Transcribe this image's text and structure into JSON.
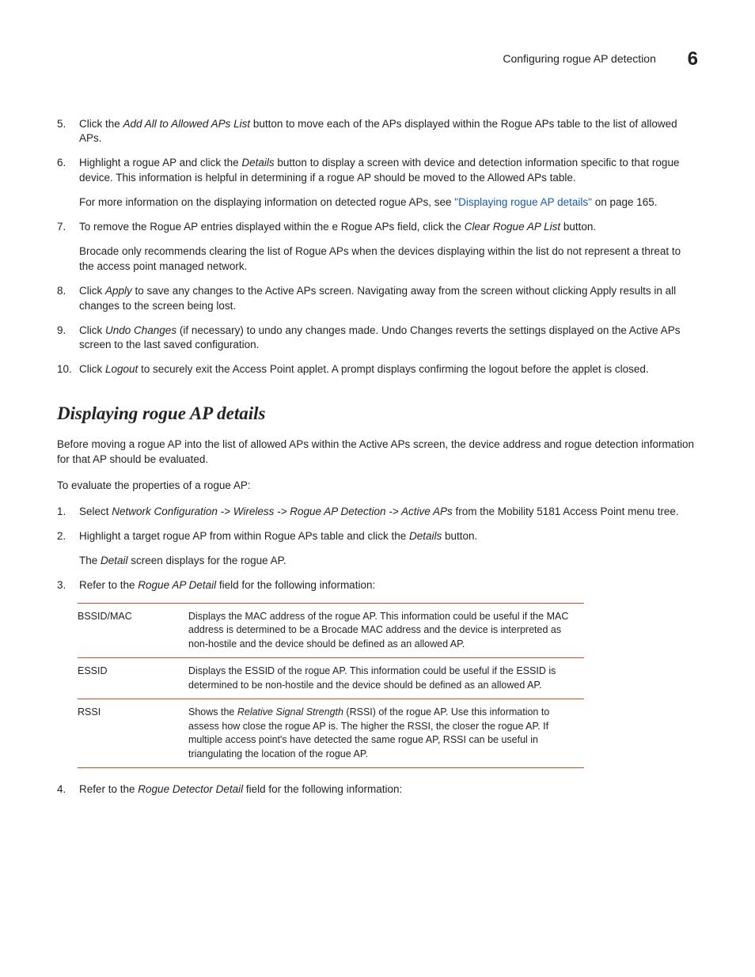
{
  "header": {
    "title": "Configuring rogue AP detection",
    "chapter": "6"
  },
  "list1": [
    {
      "num": "5.",
      "paras": [
        {
          "runs": [
            {
              "t": "Click the "
            },
            {
              "t": "Add All to Allowed APs List",
              "i": true
            },
            {
              "t": " button to move each of the APs displayed within the Rogue APs table to the list of allowed APs."
            }
          ]
        }
      ]
    },
    {
      "num": "6.",
      "paras": [
        {
          "runs": [
            {
              "t": "Highlight a rogue AP and click the "
            },
            {
              "t": "Details",
              "i": true
            },
            {
              "t": " button to display a screen with device and detection information specific to that rogue device. This information is helpful in determining if a rogue AP should be moved to the Allowed APs table."
            }
          ]
        },
        {
          "runs": [
            {
              "t": "For more information on the displaying information on detected rogue APs, see "
            },
            {
              "t": "\"Displaying rogue AP details\"",
              "link": true
            },
            {
              "t": " on page 165."
            }
          ]
        }
      ]
    },
    {
      "num": "7.",
      "paras": [
        {
          "runs": [
            {
              "t": "To remove the Rogue AP entries displayed within the e Rogue APs field, click the "
            },
            {
              "t": "Clear Rogue AP List",
              "i": true
            },
            {
              "t": " button."
            }
          ]
        },
        {
          "runs": [
            {
              "t": "Brocade only recommends clearing the list of Rogue APs when the devices displaying within the list do not represent a threat to the access point managed network."
            }
          ]
        }
      ]
    },
    {
      "num": "8.",
      "paras": [
        {
          "runs": [
            {
              "t": "Click "
            },
            {
              "t": "Apply",
              "i": true
            },
            {
              "t": " to save any changes to the Active APs screen. Navigating away from the screen without clicking Apply results in all changes to the screen being lost."
            }
          ]
        }
      ]
    },
    {
      "num": "9.",
      "paras": [
        {
          "runs": [
            {
              "t": "Click "
            },
            {
              "t": "Undo Changes",
              "i": true
            },
            {
              "t": " (if necessary) to undo any changes made. Undo Changes reverts the settings displayed on the Active APs screen to the last saved configuration."
            }
          ]
        }
      ]
    },
    {
      "num": "10.",
      "paras": [
        {
          "runs": [
            {
              "t": "Click "
            },
            {
              "t": "Logout",
              "i": true
            },
            {
              "t": " to securely exit the Access Point applet. A prompt displays confirming the logout before the applet is closed."
            }
          ]
        }
      ]
    }
  ],
  "section": {
    "title": "Displaying rogue AP details",
    "intro": "Before moving a rogue AP into the list of allowed APs within the Active APs screen, the device address and rogue detection information for that AP should be evaluated.",
    "lead": "To evaluate the properties of a rogue AP:"
  },
  "list2": [
    {
      "num": "1.",
      "paras": [
        {
          "runs": [
            {
              "t": "Select "
            },
            {
              "t": "Network Configuration -> Wireless -> Rogue AP Detection -> Active APs",
              "i": true
            },
            {
              "t": " from the Mobility 5181 Access Point menu tree."
            }
          ]
        }
      ]
    },
    {
      "num": "2.",
      "paras": [
        {
          "runs": [
            {
              "t": "Highlight a target rogue AP from within Rogue APs table and click the "
            },
            {
              "t": "Details",
              "i": true
            },
            {
              "t": " button."
            }
          ]
        },
        {
          "runs": [
            {
              "t": "The "
            },
            {
              "t": "Detail",
              "i": true
            },
            {
              "t": " screen displays for the rogue AP."
            }
          ]
        }
      ]
    },
    {
      "num": "3.",
      "paras": [
        {
          "runs": [
            {
              "t": "Refer to the "
            },
            {
              "t": "Rogue AP Detail",
              "i": true
            },
            {
              "t": " field for the following information:"
            }
          ]
        }
      ]
    }
  ],
  "table": [
    {
      "term": "BSSID/MAC",
      "desc": {
        "runs": [
          {
            "t": "Displays the MAC address of the rogue AP. This information could be useful if the MAC address is determined to be a Brocade MAC address and the device is interpreted as non-hostile and the device should be defined as an allowed AP."
          }
        ]
      }
    },
    {
      "term": "ESSID",
      "desc": {
        "runs": [
          {
            "t": "Displays the ESSID of the rogue AP. This information could be useful if the ESSID is determined to be non-hostile and the device should be defined as an allowed AP."
          }
        ]
      }
    },
    {
      "term": "RSSI",
      "desc": {
        "runs": [
          {
            "t": "Shows the "
          },
          {
            "t": "Relative Signal Strength",
            "i": true
          },
          {
            "t": " (RSSI) of the rogue AP. Use this information to assess how close the rogue AP is. The higher the RSSI, the closer the rogue AP. If multiple access point's have detected the same rogue AP, RSSI can be useful in triangulating the location of the rogue AP."
          }
        ]
      }
    }
  ],
  "list3": [
    {
      "num": "4.",
      "paras": [
        {
          "runs": [
            {
              "t": "Refer to the "
            },
            {
              "t": "Rogue Detector Detail",
              "i": true
            },
            {
              "t": " field for the following information:"
            }
          ]
        }
      ]
    }
  ]
}
